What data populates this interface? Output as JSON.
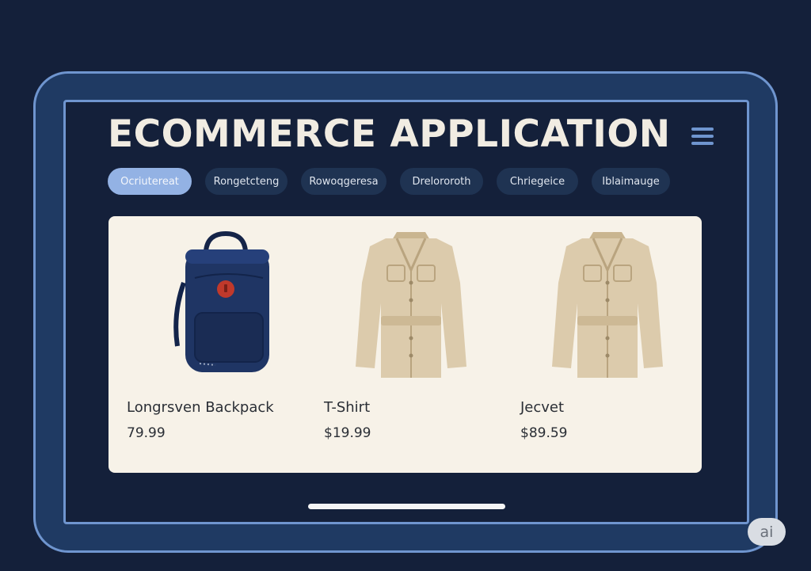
{
  "app": {
    "title": "ECOMMERCE APPLICATION",
    "menu_icon": "hamburger-menu-icon"
  },
  "tabs": [
    {
      "label": "Ocriutereat",
      "active": true
    },
    {
      "label": "Rongetcteng",
      "active": false
    },
    {
      "label": "Rowoqgeresa",
      "active": false
    },
    {
      "label": "Drelororoth",
      "active": false
    },
    {
      "label": "Chriegeice",
      "active": false
    },
    {
      "label": "Iblaimauge",
      "active": false
    }
  ],
  "products": [
    {
      "name": "Longrsven Backpack",
      "price": "79.99",
      "image": "backpack-image"
    },
    {
      "name": "T-Shirt",
      "price": "$19.99",
      "image": "shirt-image"
    },
    {
      "name": "Jecvet",
      "price": "$89.59",
      "image": "jacket-image"
    }
  ],
  "badge": {
    "label": "ai"
  },
  "colors": {
    "background": "#14203a",
    "device_frame": "#1f3a63",
    "frame_border": "#6f95cf",
    "active_tab": "#93b2e4",
    "tab": "#1f3352",
    "panel": "#f7f2e8",
    "backpack": "#1f3564",
    "backpack_logo": "#c0392b",
    "garment": "#dccbac"
  }
}
